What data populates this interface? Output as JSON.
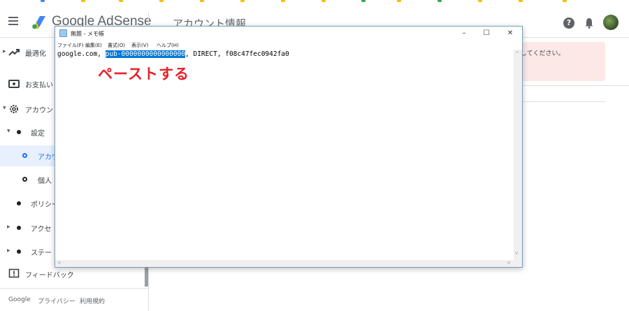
{
  "header": {
    "brand_prefix": "Google",
    "brand_suffix": " AdSense",
    "page_title": "アカウント情報",
    "help_glyph": "?"
  },
  "sidebar": {
    "items": [
      {
        "label": "最適化"
      },
      {
        "label": "お支払い"
      },
      {
        "label": "アカウン"
      },
      {
        "label": "設定"
      },
      {
        "label": "アカウ"
      },
      {
        "label": "個人"
      },
      {
        "label": "ポリシー"
      },
      {
        "label": "アクセ"
      },
      {
        "label": "ステー"
      },
      {
        "label": "フィードバック"
      }
    ],
    "footer": {
      "google": "Google",
      "privacy": "プライバシー",
      "terms": "利用規約"
    }
  },
  "main": {
    "alert_text": "正してください。"
  },
  "notepad": {
    "title": "無題 - メモ帳",
    "menus": [
      "ファイル(F)",
      "編集(E)",
      "書式(O)",
      "表示(V)",
      "ヘルプ(H)"
    ],
    "controls": {
      "minimize": "–",
      "maximize": "☐",
      "close": "✕"
    },
    "line_before": "google.com, ",
    "line_selected": "pub-0000000000000000",
    "line_after": ", DIRECT, f08c47fec0942fa0",
    "scroll_up": "^",
    "scroll_down": "v",
    "scroll_left": "<",
    "scroll_right": ">"
  },
  "annotation": "ペーストする",
  "colors": {
    "accent": "#1a73e8",
    "selection": "#0078d7",
    "annotation": "#e8202a",
    "alert_bg": "#fce8e6"
  }
}
